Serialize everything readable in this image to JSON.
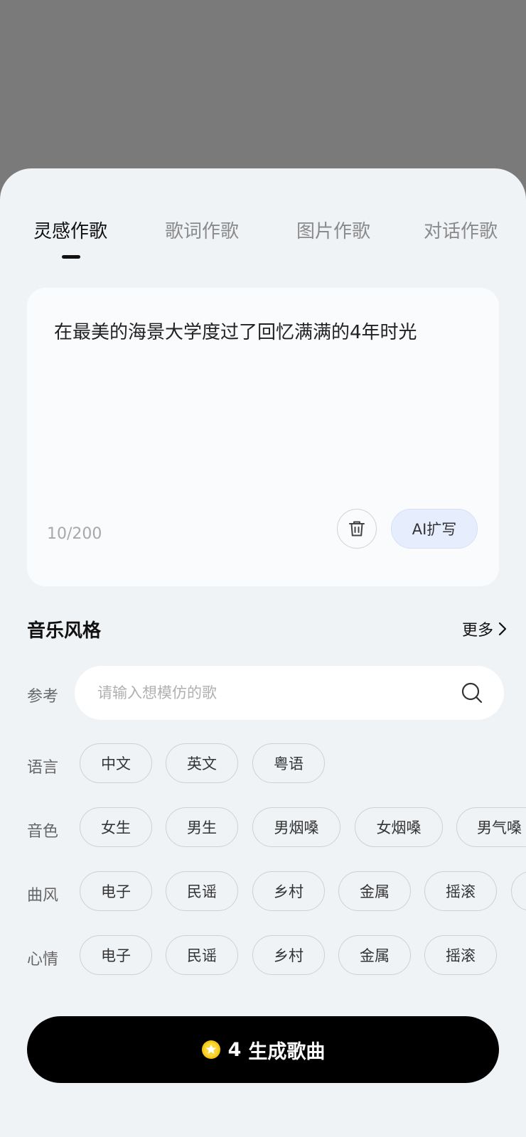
{
  "tabs": [
    {
      "label": "灵感作歌",
      "active": true
    },
    {
      "label": "歌词作歌",
      "active": false
    },
    {
      "label": "图片作歌",
      "active": false
    },
    {
      "label": "对话作歌",
      "active": false
    }
  ],
  "prompt": {
    "text": "在最美的海景大学度过了回忆满满的4年时光",
    "count": "10/200",
    "ai_expand_label": "AI扩写"
  },
  "style_section": {
    "title": "音乐风格",
    "more_label": "更多"
  },
  "reference": {
    "label": "参考",
    "placeholder": "请输入想模仿的歌"
  },
  "language": {
    "label": "语言",
    "options": [
      "中文",
      "英文",
      "粤语"
    ]
  },
  "timbre": {
    "label": "音色",
    "options": [
      "女生",
      "男生",
      "男烟嗓",
      "女烟嗓",
      "男气嗓"
    ]
  },
  "genre": {
    "label": "曲风",
    "options": [
      "电子",
      "民谣",
      "乡村",
      "金属",
      "摇滚",
      ""
    ]
  },
  "mood": {
    "label": "心情",
    "options": [
      "电子",
      "民谣",
      "乡村",
      "金属",
      "摇滚"
    ]
  },
  "generate": {
    "cost": "4",
    "label": "生成歌曲"
  },
  "colors": {
    "overlay": "#7a7a7a",
    "sheet_bg": "#f0f3f6",
    "primary_button": "#000000",
    "ai_button_bg": "#e6eefd",
    "coin": "#f5c518"
  }
}
